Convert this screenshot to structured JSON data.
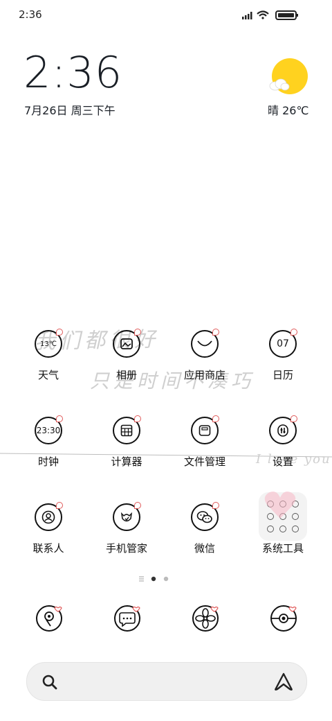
{
  "status_bar": {
    "time": "2:36"
  },
  "clock_widget": {
    "time": "2:36",
    "date": "7月26日 周三下午",
    "weather": "晴 26℃"
  },
  "handwriting": {
    "line1": "我们都很好",
    "line2": "只是时间不凑巧",
    "line3": "I love you"
  },
  "apps": [
    {
      "label": "天气",
      "icon_text": "13℃",
      "icon": "weather-icon"
    },
    {
      "label": "相册",
      "icon": "gallery-icon"
    },
    {
      "label": "应用商店",
      "icon": "app-store-icon"
    },
    {
      "label": "日历",
      "icon_text": "07",
      "icon": "calendar-icon"
    },
    {
      "label": "时钟",
      "icon_text": "23:30",
      "icon": "clock-icon"
    },
    {
      "label": "计算器",
      "icon": "calculator-icon"
    },
    {
      "label": "文件管理",
      "icon": "file-manager-icon"
    },
    {
      "label": "设置",
      "icon": "settings-icon"
    },
    {
      "label": "联系人",
      "icon": "contacts-icon"
    },
    {
      "label": "手机管家",
      "icon": "security-icon"
    },
    {
      "label": "微信",
      "icon": "wechat-icon"
    },
    {
      "label": "系统工具",
      "icon": "folder-icon"
    }
  ],
  "dock": [
    {
      "icon": "phone-icon"
    },
    {
      "icon": "messages-icon"
    },
    {
      "icon": "browser-icon"
    },
    {
      "icon": "camera-icon"
    }
  ],
  "colors": {
    "sun": "#FFD21F",
    "badge": "#E05A5A",
    "ink": "#111111"
  }
}
